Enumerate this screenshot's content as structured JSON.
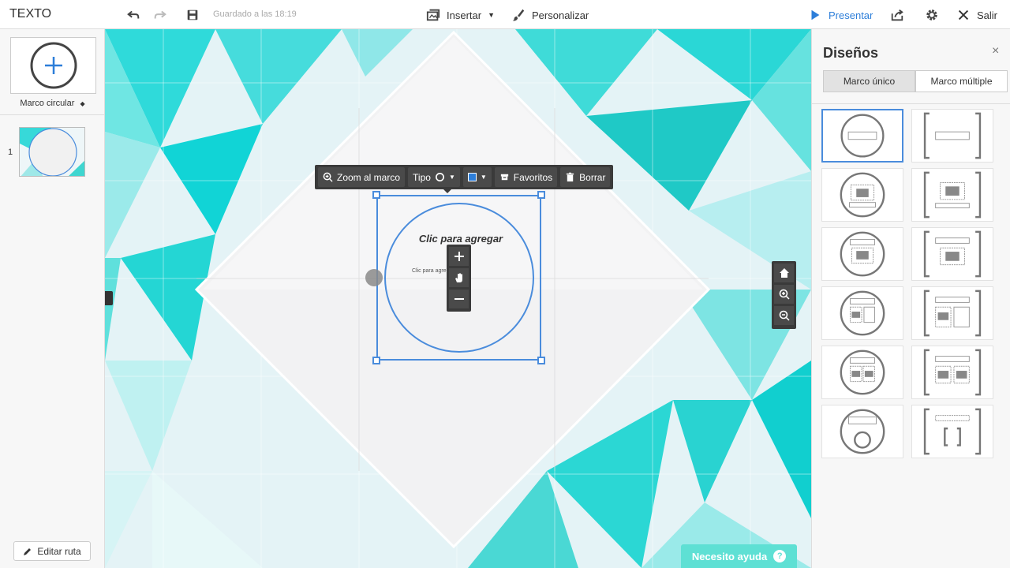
{
  "topbar": {
    "title": "TEXTO",
    "saved": "Guardado a las 18:19",
    "insert_label": "Insertar",
    "customize_label": "Personalizar",
    "present_label": "Presentar",
    "exit_label": "Salir",
    "accent": "#2d7ed9"
  },
  "leftpanel": {
    "frame_type": "Marco circular",
    "slide_number": "1",
    "edit_route": "Editar ruta"
  },
  "frame_toolbar": {
    "zoom": "Zoom al marco",
    "type": "Tipo",
    "favorites": "Favoritos",
    "delete": "Borrar",
    "frame_color": "#2d7ed9"
  },
  "canvas": {
    "placeholder_big": "Clic para agregar",
    "placeholder_small": "Clic para agregar",
    "help": "Necesito ayuda"
  },
  "rightpanel": {
    "title": "Diseños",
    "close": "×",
    "tabs": [
      "Marco único",
      "Marco múltiple"
    ],
    "active_tab": "Marco único"
  },
  "icons": [
    "undo-icon",
    "redo-icon",
    "save-icon",
    "insert-icon",
    "brush-icon",
    "play-icon",
    "share-icon",
    "gear-icon",
    "close-icon",
    "pencil-icon",
    "home-icon",
    "zoom-in-icon",
    "zoom-out-icon",
    "hand-icon",
    "plus-icon",
    "minus-icon",
    "trash-icon",
    "favorites-icon"
  ]
}
